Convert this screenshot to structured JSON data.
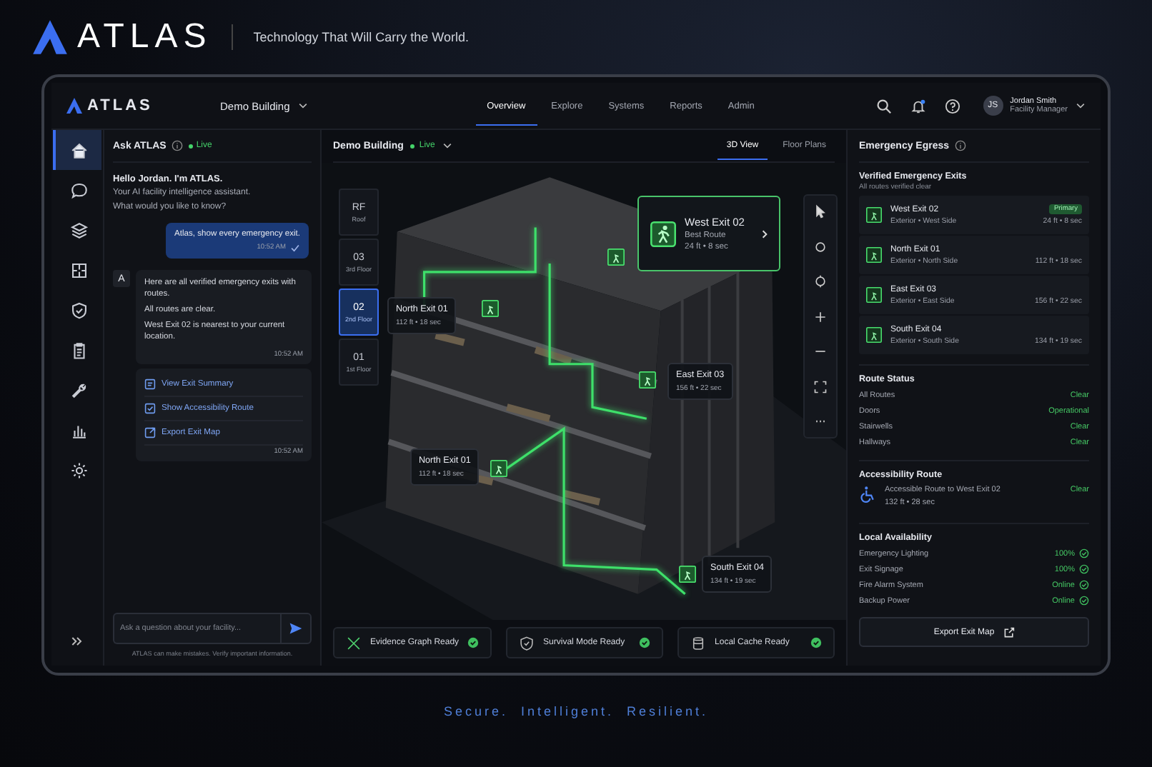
{
  "hero": {
    "logo": "ATLAS",
    "tagline": "Technology That Will Carry the World."
  },
  "topbar": {
    "logo": "ATLAS",
    "building": "Demo Building",
    "nav": [
      {
        "label": "Overview",
        "selected": true
      },
      {
        "label": "Explore",
        "selected": false
      },
      {
        "label": "Systems",
        "selected": false
      },
      {
        "label": "Reports",
        "selected": false
      },
      {
        "label": "Admin",
        "selected": false
      }
    ],
    "user": {
      "initials": "JS",
      "name": "Jordan Smith",
      "role": "Facility Manager"
    }
  },
  "rail": [
    {
      "selected": true
    },
    {
      "selected": false
    },
    {
      "selected": false
    },
    {
      "selected": false
    },
    {
      "selected": false
    },
    {
      "selected": false
    },
    {
      "selected": false
    },
    {
      "selected": false
    },
    {
      "selected": false
    }
  ],
  "chat": {
    "title": "Ask ATLAS",
    "status": "Live",
    "intro": {
      "heading": "Hello Jordan. I'm ATLAS.",
      "lines": [
        "Your AI facility intelligence assistant.",
        "What would you like to know?"
      ]
    },
    "user_message": {
      "text": "Atlas, show every emergency exit.",
      "time": "10:52 AM"
    },
    "reply": {
      "avatar": "A",
      "paragraphs": [
        "Here are all verified emergency exits with routes.",
        "All routes are clear.",
        "West Exit 02 is nearest to your current location."
      ],
      "time": "10:52 AM"
    },
    "actions": {
      "items": [
        "View Exit Summary",
        "Show Accessibility Route",
        "Export Exit Map"
      ],
      "time": "10:52 AM"
    },
    "input": {
      "placeholder": "Ask a question about your facility..."
    },
    "disclaimer": "ATLAS can make mistakes. Verify important information."
  },
  "viewer": {
    "title": "Demo Building",
    "status": "Live",
    "tabs": [
      {
        "label": "3D View",
        "selected": true
      },
      {
        "label": "Floor Plans",
        "selected": false
      }
    ],
    "floors": [
      {
        "code": "RF",
        "name": "Roof",
        "selected": false
      },
      {
        "code": "03",
        "name": "3rd Floor",
        "selected": false
      },
      {
        "code": "02",
        "name": "2nd Floor",
        "selected": true
      },
      {
        "code": "01",
        "name": "1st Floor",
        "selected": false
      }
    ],
    "featured": {
      "title": "West Exit 02",
      "subtitle": "Best Route",
      "detail": "24 ft • 8 sec"
    },
    "callouts": [
      {
        "title": "North Exit 01",
        "detail": "112 ft • 18 sec"
      },
      {
        "title": "East Exit 03",
        "detail": "156 ft • 22 sec"
      },
      {
        "title": "North Exit 01",
        "detail": "112 ft • 18 sec"
      },
      {
        "title": "South Exit 04",
        "detail": "134 ft • 19 sec"
      }
    ],
    "chips": [
      "Evidence Graph Ready",
      "Survival Mode Ready",
      "Local Cache Ready"
    ]
  },
  "egress": {
    "title": "Emergency Egress",
    "exits_title": "Verified Emergency Exits",
    "exits_subtitle": "All routes verified clear",
    "exits": [
      {
        "name": "West Exit 02",
        "location": "Exterior • West Side",
        "distance": "24 ft • 8 sec",
        "badge": "Primary"
      },
      {
        "name": "North Exit 01",
        "location": "Exterior • North Side",
        "distance": "112 ft • 18 sec"
      },
      {
        "name": "East Exit 03",
        "location": "Exterior • East Side",
        "distance": "156 ft • 22 sec"
      },
      {
        "name": "South Exit 04",
        "location": "Exterior • South Side",
        "distance": "134 ft • 19 sec"
      }
    ],
    "route_title": "Route Status",
    "routes": [
      {
        "label": "All Routes",
        "value": "Clear"
      },
      {
        "label": "Doors",
        "value": "Operational"
      },
      {
        "label": "Stairwells",
        "value": "Clear"
      },
      {
        "label": "Hallways",
        "value": "Clear"
      }
    ],
    "access_title": "Accessibility Route",
    "access": {
      "route": "Accessible Route to West Exit 02",
      "detail": "132 ft • 28 sec",
      "status": "Clear"
    },
    "avail_title": "Local Availability",
    "avail": [
      {
        "label": "Emergency Lighting",
        "value": "100%"
      },
      {
        "label": "Exit Signage",
        "value": "100%"
      },
      {
        "label": "Fire Alarm System",
        "value": "Online"
      },
      {
        "label": "Backup Power",
        "value": "Online"
      }
    ],
    "export": "Export Exit Map"
  },
  "footer_tagline": "Secure.  Intelligent.  Resilient."
}
